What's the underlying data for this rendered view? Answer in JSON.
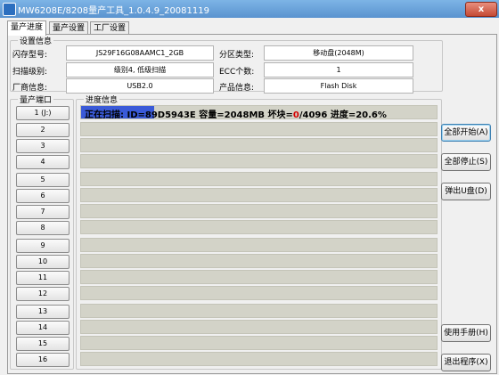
{
  "window": {
    "title": "MW6208E/8208量产工具_1.0.4.9_20081119",
    "close_label": "x"
  },
  "tabs": [
    {
      "label": "量产进度",
      "active": true
    },
    {
      "label": "量产设置",
      "active": false
    },
    {
      "label": "工厂设置",
      "active": false
    }
  ],
  "settings": {
    "group_label": "设置信息",
    "flash_model_label": "闪存型号:",
    "flash_model_value": "JS29F16G08AAMC1_2GB",
    "partition_type_label": "分区类型:",
    "partition_type_value": "移动盘(2048M)",
    "scan_level_label": "扫描级别:",
    "scan_level_value": "级别4, 低级扫描",
    "ecc_label": "ECC个数:",
    "ecc_value": "1",
    "vendor_info_label": "厂商信息:",
    "vendor_info_value": "USB2.0",
    "product_info_label": "产品信息:",
    "product_info_value": "Flash Disk"
  },
  "ports": {
    "group_label": "量产端口",
    "buttons": [
      "1 (J:)",
      "2",
      "3",
      "4",
      "5",
      "6",
      "7",
      "8",
      "9",
      "10",
      "11",
      "12",
      "13",
      "14",
      "15",
      "16"
    ]
  },
  "progress": {
    "group_label": "进度信息",
    "row1": {
      "prefix": "正在扫描: ID=89D5943E 容量=2048MB 坏块=",
      "bad": "0",
      "suffix": "/4096 进度=20.6%",
      "percent": 20.6,
      "bad_color": "#d40000",
      "fill_color": "#3a5ad8"
    }
  },
  "actions": {
    "start_all": "全部开始(A)",
    "stop_all": "全部停止(S)",
    "eject": "弹出U盘(D)",
    "manual": "使用手册(H)",
    "exit": "退出程序(X)"
  }
}
